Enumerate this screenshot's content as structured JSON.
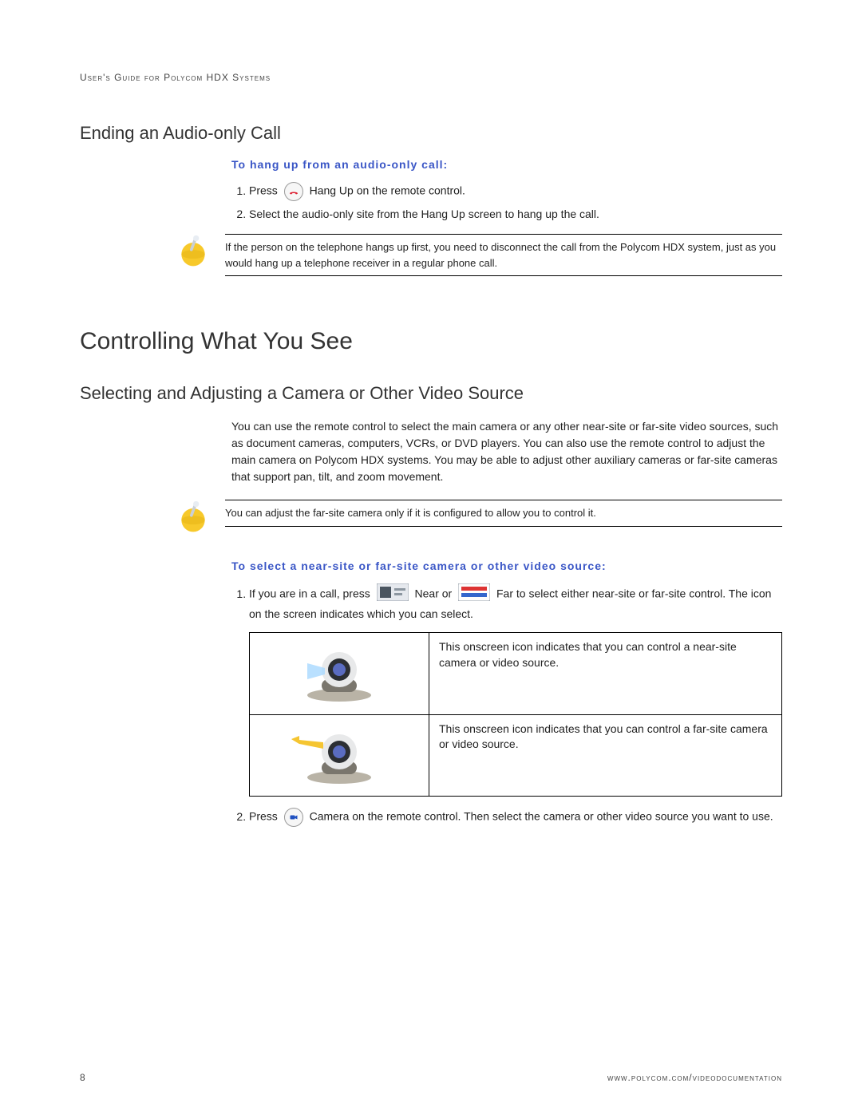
{
  "header": {
    "running": "User's Guide for Polycom HDX Systems"
  },
  "section_end_call": {
    "heading": "Ending an Audio-only Call",
    "task": "To hang up from an audio-only call:",
    "steps": [
      {
        "pre": "Press ",
        "btn_name": "hangup-button-icon",
        "post": " Hang Up on the remote control."
      },
      {
        "text": "Select the audio-only site from the Hang Up screen to hang up the call."
      }
    ],
    "note": "If the person on the telephone hangs up first, you need to disconnect the call from the Polycom HDX system, just as you would hang up a telephone receiver in a regular phone call."
  },
  "section_controlling": {
    "heading": "Controlling What You See",
    "subheading": "Selecting and Adjusting a Camera or Other Video Source",
    "intro": "You can use the remote control to select the main camera or any other near-site or far-site video sources, such as document cameras, computers, VCRs, or DVD players. You can also use the remote control to adjust the main camera on Polycom HDX systems. You may be able to adjust other auxiliary cameras or far-site cameras that support pan, tilt, and zoom movement.",
    "note": "You can adjust the far-site camera only if it is configured to allow you to control it.",
    "task": "To select a near-site or far-site camera or other video source:",
    "step1": {
      "pre": "If you are in a call, press ",
      "near_label": " Near or ",
      "far_label": " Far to select either near-site or far-site control. The icon on the screen indicates which you can select."
    },
    "table": [
      {
        "icon_name": "camera-near-icon",
        "desc": "This onscreen icon indicates that you can control a near-site camera or video source."
      },
      {
        "icon_name": "camera-far-icon",
        "desc": "This onscreen icon indicates that you can control a far-site camera or video source."
      }
    ],
    "step2": {
      "pre": "Press ",
      "btn_name": "camera-button-icon",
      "post": " Camera on the remote control. Then select the camera or other video source you want to use."
    }
  },
  "footer": {
    "page": "8",
    "url": "www.polycom.com/videodocumentation"
  }
}
